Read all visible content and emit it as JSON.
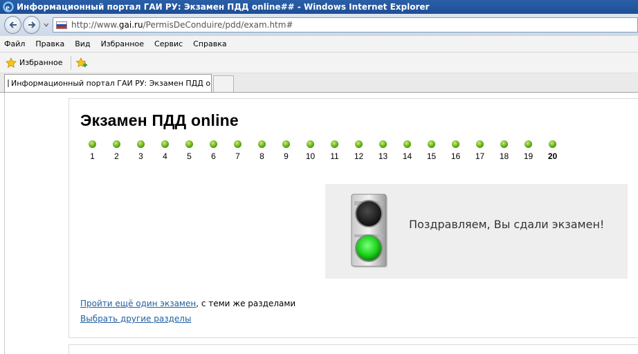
{
  "window": {
    "title": "Информационный портал ГАИ РУ: Экзамен ПДД online## - Windows Internet Explorer",
    "colors": {
      "titlebar": "#1e4f95",
      "link": "#1f5fa0",
      "dot": "#5aa612"
    }
  },
  "address": {
    "prefix": "http://www.",
    "host": "gai.ru",
    "path": "/PermisDeConduire/pdd/exam.htm#"
  },
  "menu": [
    "Файл",
    "Правка",
    "Вид",
    "Избранное",
    "Сервис",
    "Справка"
  ],
  "favorites": {
    "label": "Избранное"
  },
  "tab": {
    "title": "Информационный портал ГАИ РУ: Экзамен ПДД onl..."
  },
  "page": {
    "title": "Экзамен ПДД online",
    "questions": [
      "1",
      "2",
      "3",
      "4",
      "5",
      "6",
      "7",
      "8",
      "9",
      "10",
      "11",
      "12",
      "13",
      "14",
      "15",
      "16",
      "17",
      "18",
      "19",
      "20"
    ],
    "current_question": "20",
    "result_message": "Поздравляем, Вы сдали экзамен!",
    "retake_link": "Пройти ещё один экзамен",
    "retake_suffix": ", с теми же разделами",
    "choose_link": "Выбрать другие разделы"
  }
}
